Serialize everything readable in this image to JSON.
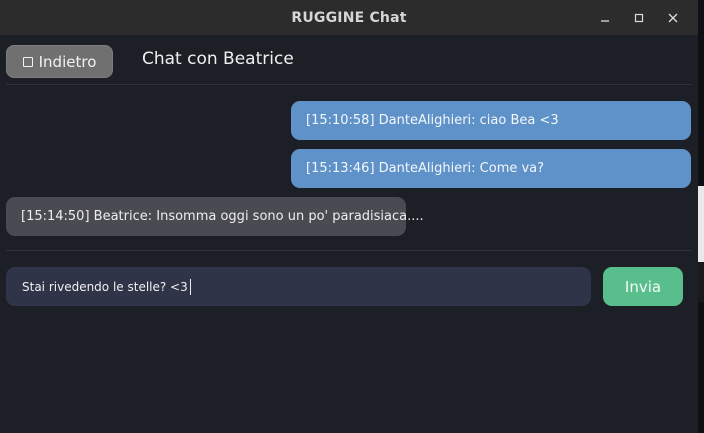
{
  "window": {
    "title": "RUGGINE Chat",
    "controls": [
      "minimize-icon",
      "maximize-icon",
      "close-icon"
    ]
  },
  "header": {
    "back_label": "Indietro",
    "chat_title": "Chat con Beatrice"
  },
  "messages": [
    {
      "direction": "sent",
      "text": "[15:10:58] DanteAlighieri: ciao Bea <3"
    },
    {
      "direction": "sent",
      "text": "[15:13:46] DanteAlighieri: Come va?"
    },
    {
      "direction": "received",
      "text": "[15:14:50] Beatrice: Insomma oggi sono un po' paradisiaca...."
    }
  ],
  "composer": {
    "value": "Stai rivedendo le stelle? <3",
    "send_label": "Invia"
  },
  "colors": {
    "sent_bubble": "#5f92c9",
    "received_bubble": "#4a4b52",
    "send_button": "#58bf8c",
    "input_background": "#303449",
    "back_button": "#707070"
  }
}
